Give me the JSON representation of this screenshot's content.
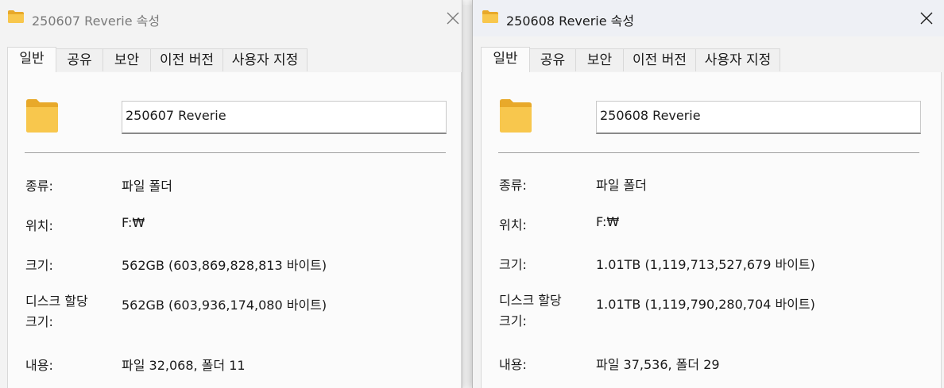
{
  "windows": [
    {
      "title": "250607 Reverie 속성",
      "tabs": [
        "일반",
        "공유",
        "보안",
        "이전 버전",
        "사용자 지정"
      ],
      "active_tab": "일반",
      "name_value": "250607 Reverie",
      "properties": {
        "type_label": "종류:",
        "type_value": "파일 폴더",
        "location_label": "위치:",
        "location_value": "F:₩",
        "size_label": "크기:",
        "size_value": "562GB (603,869,828,813 바이트)",
        "disk_size_label": "디스크 할당 크기:",
        "disk_size_value": "562GB (603,936,174,080 바이트)",
        "contents_label": "내용:",
        "contents_value": "파일 32,068, 폴더 11"
      }
    },
    {
      "title": "250608 Reverie 속성",
      "tabs": [
        "일반",
        "공유",
        "보안",
        "이전 버전",
        "사용자 지정"
      ],
      "active_tab": "일반",
      "name_value": "250608 Reverie",
      "properties": {
        "type_label": "종류:",
        "type_value": "파일 폴더",
        "location_label": "위치:",
        "location_value": "F:₩",
        "size_label": "크기:",
        "size_value": "1.01TB (1,119,713,527,679 바이트)",
        "disk_size_label": "디스크 할당 크기:",
        "disk_size_value": "1.01TB (1,119,790,280,704 바이트)",
        "contents_label": "내용:",
        "contents_value": "파일 37,536, 폴더 29"
      }
    }
  ],
  "icons": {
    "title_icon": "folder-icon",
    "close_icon": "close-icon",
    "big_icon": "folder-icon"
  },
  "colors": {
    "folder_yellow": "#f8c74d",
    "folder_back": "#e8a92a",
    "panel_bg": "#fbfbfb",
    "window_bg": "#f3f3f3",
    "inactive_title_text": "#7a7a7a"
  }
}
